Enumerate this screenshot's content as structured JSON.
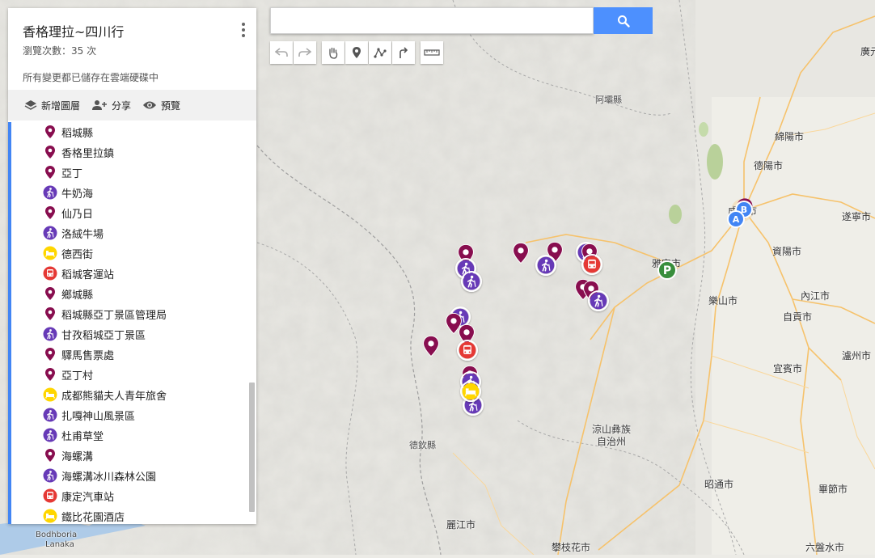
{
  "map": {
    "title": "香格理拉~四川行",
    "views": "瀏覽次數：35 次",
    "saved_status": "所有變更都已儲存在雲端硬碟中",
    "toolbar": {
      "add_layer": "新增圖層",
      "share": "分享",
      "preview": "預覽"
    }
  },
  "list_items": [
    {
      "label": "稻城縣",
      "icon": "pin-icon"
    },
    {
      "label": "香格里拉鎮",
      "icon": "pin-icon"
    },
    {
      "label": "亞丁",
      "icon": "pin-icon"
    },
    {
      "label": "牛奶海",
      "icon": "hiking-icon"
    },
    {
      "label": "仙乃日",
      "icon": "pin-icon"
    },
    {
      "label": "洛絨牛場",
      "icon": "hiking-icon"
    },
    {
      "label": "德西街",
      "icon": "hotel-icon"
    },
    {
      "label": "稻城客運站",
      "icon": "bus-icon"
    },
    {
      "label": "鄉城縣",
      "icon": "pin-icon"
    },
    {
      "label": "稻城縣亞丁景區管理局",
      "icon": "pin-icon"
    },
    {
      "label": "甘孜稻城亞丁景區",
      "icon": "hiking-icon"
    },
    {
      "label": "驛馬售票處",
      "icon": "pin-icon"
    },
    {
      "label": "亞丁村",
      "icon": "pin-icon"
    },
    {
      "label": "成都熊貓夫人青年旅舍",
      "icon": "hotel-icon"
    },
    {
      "label": "扎嘎神山風景區",
      "icon": "hiking-icon"
    },
    {
      "label": "杜甫草堂",
      "icon": "hiking-icon"
    },
    {
      "label": "海螺溝",
      "icon": "pin-icon"
    },
    {
      "label": "海螺溝冰川森林公園",
      "icon": "hiking-icon"
    },
    {
      "label": "康定汽車站",
      "icon": "bus-icon"
    },
    {
      "label": "鐵比花園酒店",
      "icon": "hotel-icon"
    }
  ],
  "map_labels": {
    "l1": "阿壩縣",
    "l2": "綿陽市",
    "l3": "德陽市",
    "l4": "成都市",
    "l5": "遂寧市",
    "l6": "資陽市",
    "l7": "雅安市",
    "l8": "樂山市",
    "l9": "內江市",
    "l10": "自貢市",
    "l11": "宜賓市",
    "l12": "瀘州市",
    "l13": "涼山彝族",
    "l14": "自治州",
    "l15": "德欽縣",
    "l16": "麗江市",
    "l17": "攀枝花市",
    "l18": "昭通市",
    "l19": "畢節市",
    "l20": "六盤水市",
    "l21": "廣元",
    "l22": "Bodhboria",
    "l23": "Lanaka"
  },
  "colors": {
    "pin": "#880e4f",
    "hiking": "#673ab7",
    "hotel": "#ffd600",
    "bus": "#e53935",
    "accent": "#4285f4",
    "parking": "#388e3c",
    "search_btn": "#4d90fe"
  }
}
